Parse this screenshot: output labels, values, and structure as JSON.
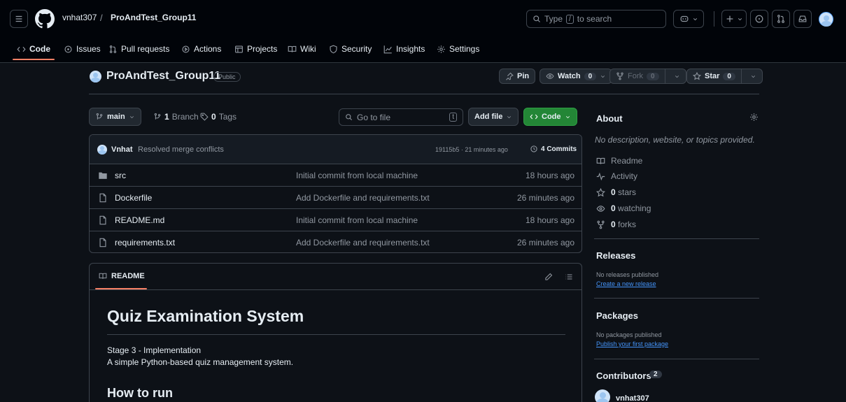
{
  "header": {
    "owner": "vnhat307",
    "separator": "/",
    "repo": "ProAndTest_Group11",
    "search_label": "Type",
    "search_key": "/",
    "search_suffix": "to search"
  },
  "tabs": [
    {
      "label": "Code",
      "icon": "code-icon"
    },
    {
      "label": "Issues",
      "icon": "issue-icon"
    },
    {
      "label": "Pull requests",
      "icon": "pull-request-icon"
    },
    {
      "label": "Actions",
      "icon": "play-icon"
    },
    {
      "label": "Projects",
      "icon": "table-icon"
    },
    {
      "label": "Wiki",
      "icon": "book-icon"
    },
    {
      "label": "Security",
      "icon": "shield-icon"
    },
    {
      "label": "Insights",
      "icon": "graph-icon"
    },
    {
      "label": "Settings",
      "icon": "gear-icon"
    }
  ],
  "repo": {
    "name": "ProAndTest_Group11",
    "visibility": "Public",
    "pin_label": "Pin",
    "watch_label": "Watch",
    "watch_count": "0",
    "fork_label": "Fork",
    "fork_count": "0",
    "star_label": "Star",
    "star_count": "0"
  },
  "toolbar": {
    "branch": "main",
    "branch_count": "1",
    "branch_word": "Branch",
    "tag_count": "0",
    "tag_word": "Tags",
    "go_to_file": "Go to file",
    "go_to_file_key": "t",
    "add_file": "Add file",
    "code_button": "Code"
  },
  "latest_commit": {
    "author": "Vnhat",
    "message": "Resolved merge conflicts",
    "meta": "19115b5 · 21 minutes ago",
    "commits_label": "4 Commits"
  },
  "files": [
    {
      "name": "src",
      "type": "folder",
      "message": "Initial commit from local machine",
      "time": "18 hours ago"
    },
    {
      "name": "Dockerfile",
      "type": "file",
      "message": "Add Dockerfile and requirements.txt",
      "time": "26 minutes ago"
    },
    {
      "name": "README.md",
      "type": "file",
      "message": "Initial commit from local machine",
      "time": "18 hours ago"
    },
    {
      "name": "requirements.txt",
      "type": "file",
      "message": "Add Dockerfile and requirements.txt",
      "time": "26 minutes ago"
    }
  ],
  "readme": {
    "tab_label": "README",
    "h1": "Quiz Examination System",
    "line1": "Stage 3 - Implementation",
    "line2": "A simple Python-based quiz management system.",
    "h2": "How to run"
  },
  "about": {
    "title": "About",
    "description": "No description, website, or topics provided.",
    "readme": "Readme",
    "activity": "Activity",
    "stars_count": "0",
    "stars_word": "stars",
    "watching_count": "0",
    "watching_word": "watching",
    "forks_count": "0",
    "forks_word": "forks"
  },
  "releases": {
    "title": "Releases",
    "empty": "No releases published",
    "link": "Create a new release"
  },
  "packages": {
    "title": "Packages",
    "empty": "No packages published",
    "link": "Publish your first package"
  },
  "contributors": {
    "title": "Contributors",
    "count": "2",
    "first": "vnhat307"
  },
  "colors": {
    "accent_green": "#238636",
    "tab_underline": "#f78166",
    "link": "#4493f8"
  }
}
